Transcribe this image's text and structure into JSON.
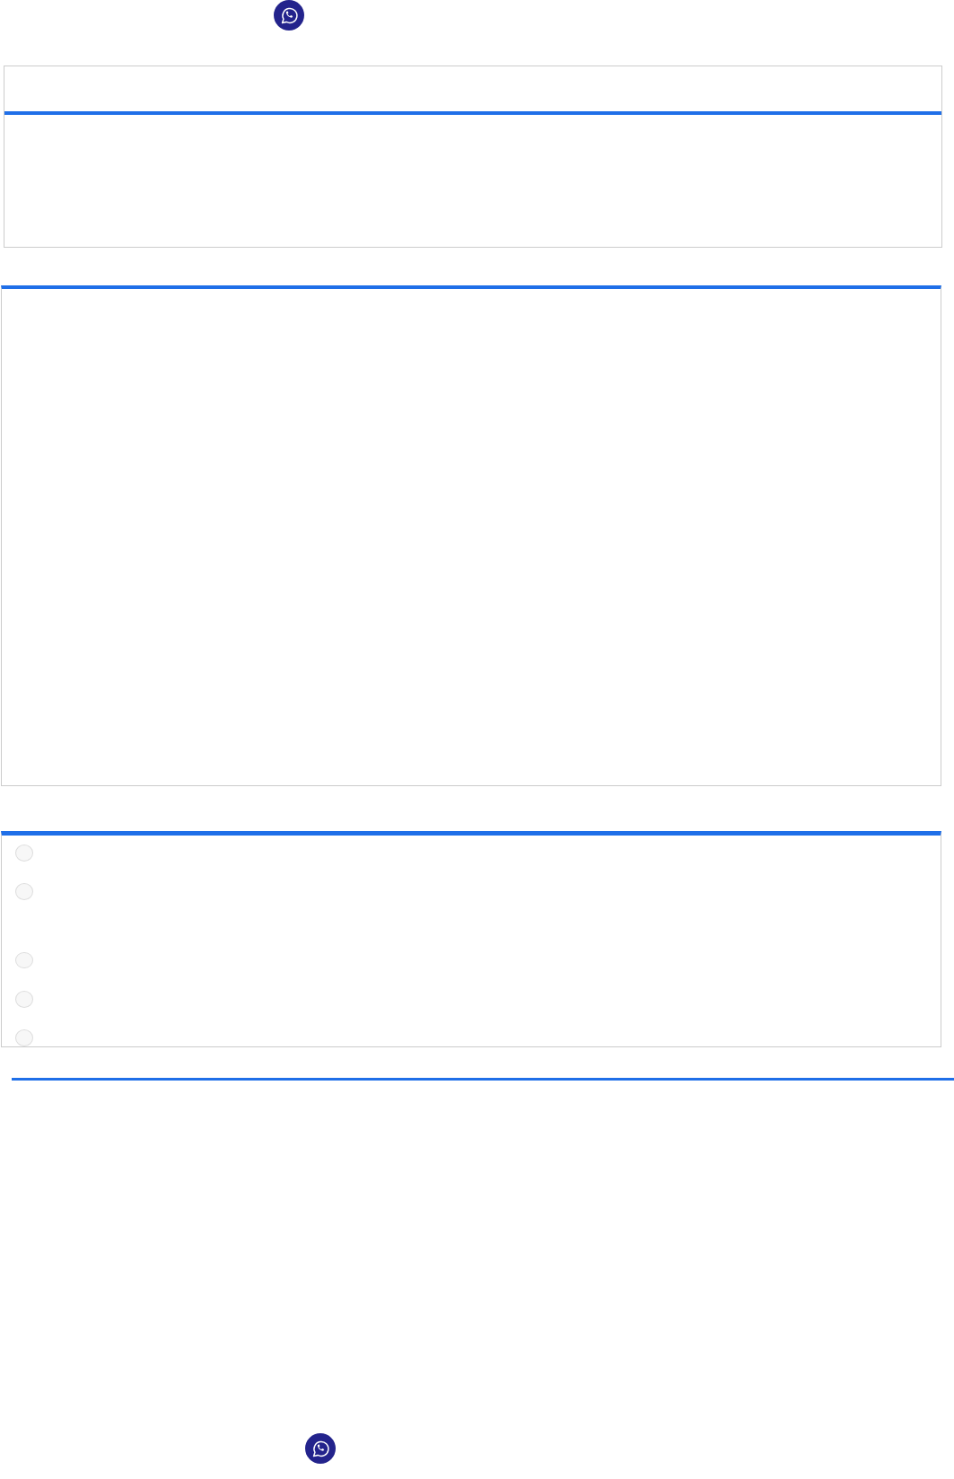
{
  "quiz": {
    "options": [
      {
        "selected": false
      },
      {
        "selected": false
      },
      {
        "selected": false
      },
      {
        "selected": false
      },
      {
        "selected": false
      }
    ]
  }
}
